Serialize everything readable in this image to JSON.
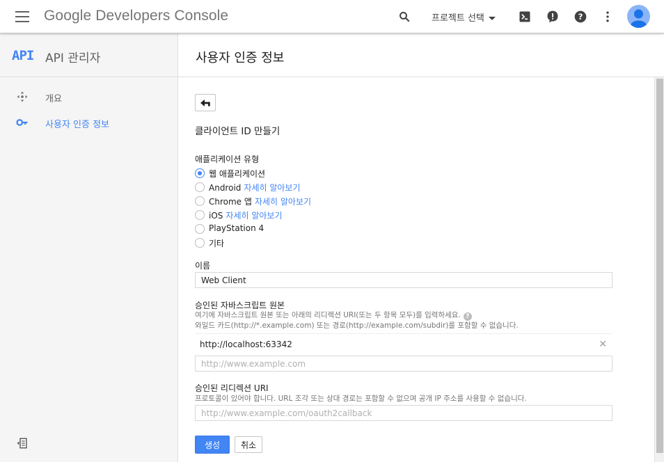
{
  "topbar": {
    "brand": "Google Developers Console",
    "project_select": "프로젝트 선택",
    "icons": [
      "menu-icon",
      "search-icon",
      "cloud-shell-icon",
      "notifications-icon",
      "help-icon",
      "more-vert-icon",
      "account-avatar"
    ]
  },
  "sidebar": {
    "logo": "API",
    "title": "API 관리자",
    "items": [
      {
        "label": "개요",
        "icon": "overview-icon",
        "active": false
      },
      {
        "label": "사용자 인증 정보",
        "icon": "key-icon",
        "active": true
      }
    ]
  },
  "page": {
    "title": "사용자 인증 정보"
  },
  "form": {
    "heading": "클라이언트 ID 만들기",
    "app_type_label": "애플리케이션 유형",
    "app_types": [
      {
        "label": "웹 애플리케이션",
        "link": "",
        "checked": true
      },
      {
        "label": "Android",
        "link": "자세히 알아보기",
        "checked": false
      },
      {
        "label": "Chrome 앱",
        "link": "자세히 알아보기",
        "checked": false
      },
      {
        "label": "iOS",
        "link": "자세히 알아보기",
        "checked": false
      },
      {
        "label": "PlayStation 4",
        "link": "",
        "checked": false
      },
      {
        "label": "기타",
        "link": "",
        "checked": false
      }
    ],
    "name_label": "이름",
    "name_value": "Web Client",
    "origins_label": "승인된 자바스크립트 원본",
    "origins_help1": "여기에 자바스크립트 원본 또는 아래의 리디렉션 URI(또는 두 항목 모두)를 입력하세요.",
    "origins_help2": "와일드 카드(http://*.example.com) 또는 경로(http://example.com/subdir)를 포함할 수 없습니다.",
    "origin_entry": "http://localhost:63342",
    "origin_placeholder": "http://www.example.com",
    "redirect_label": "승인된 리디렉션 URI",
    "redirect_help": "프로토콜이 있어야 합니다. URL 조각 또는 상대 경로는 포함할 수 없으며 공개 IP 주소를 사용할 수 없습니다.",
    "redirect_placeholder": "http://www.example.com/oauth2callback",
    "create_label": "생성",
    "cancel_label": "취소",
    "help_glyph": "?",
    "remove_glyph": "✕"
  },
  "colors": {
    "accent": "#4285f4",
    "sidebar_bg": "#f5f5f5"
  }
}
